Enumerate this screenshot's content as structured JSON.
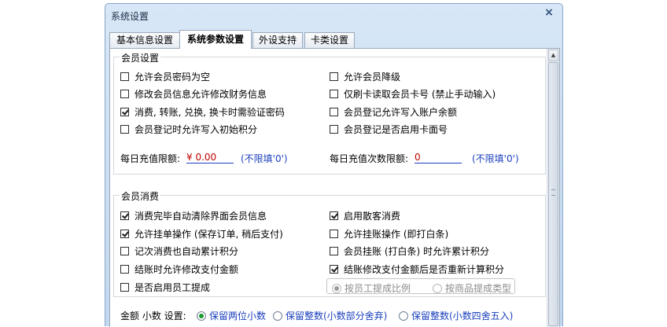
{
  "window": {
    "title": "系统设置",
    "close_glyph": "×"
  },
  "tabs": [
    {
      "label": "基本信息设置",
      "active": false
    },
    {
      "label": "系统参数设置",
      "active": true
    },
    {
      "label": "外设支持",
      "active": false
    },
    {
      "label": "卡类设置",
      "active": false
    }
  ],
  "member_settings": {
    "title": "会员设置",
    "left": [
      {
        "label": "允许会员密码为空",
        "checked": false
      },
      {
        "label": "修改会员信息允许修改财务信息",
        "checked": false
      },
      {
        "label": "消费, 转账, 兑换, 换卡时需验证密码",
        "checked": true
      },
      {
        "label": "会员登记时允许写入初始积分",
        "checked": false
      }
    ],
    "right": [
      {
        "label": "允许会员降级",
        "checked": false
      },
      {
        "label": "仅刷卡读取会员卡号 (禁止手动输入)",
        "checked": false
      },
      {
        "label": "会员登记允许写入账户余额",
        "checked": false
      },
      {
        "label": "会员登记是否启用卡面号",
        "checked": false
      }
    ],
    "daily_amount_label": "每日充值限额:",
    "daily_amount_value": "¥ 0.00",
    "daily_amount_hint": "(不限填'0')",
    "daily_count_label": "每日充值次数限额:",
    "daily_count_value": "0",
    "daily_count_hint": "(不限填'0')"
  },
  "member_consume": {
    "title": "会员消费",
    "left": [
      {
        "label": "消费完毕自动清除界面会员信息",
        "checked": true
      },
      {
        "label": "允许挂单操作 (保存订单, 稍后支付)",
        "checked": true
      },
      {
        "label": "记次消费也自动累计积分",
        "checked": false
      },
      {
        "label": "结账时允许修改支付金额",
        "checked": false
      },
      {
        "label": "是否启用员工提成",
        "checked": false
      }
    ],
    "right": [
      {
        "label": "启用散客消费",
        "checked": true
      },
      {
        "label": "允许挂账操作 (即打白条)",
        "checked": false
      },
      {
        "label": "会员挂账 (打白条) 时允许累计积分",
        "checked": false
      },
      {
        "label": "结账修改支付金额后是否重新计算积分",
        "checked": true
      }
    ],
    "commission_options": [
      {
        "label": "按员工提成比例",
        "selected": true
      },
      {
        "label": "按商品提成类型",
        "selected": false
      }
    ]
  },
  "amount_decimal": {
    "label": "金额 小数 设置:",
    "options": [
      {
        "label": "保留两位小数",
        "selected": true
      },
      {
        "label": "保留整数(小数部分舍弃)",
        "selected": false
      },
      {
        "label": "保留整数(小数四舍五入)",
        "selected": false
      }
    ]
  },
  "scrollbar": {
    "up": "▲",
    "down": "▼"
  }
}
